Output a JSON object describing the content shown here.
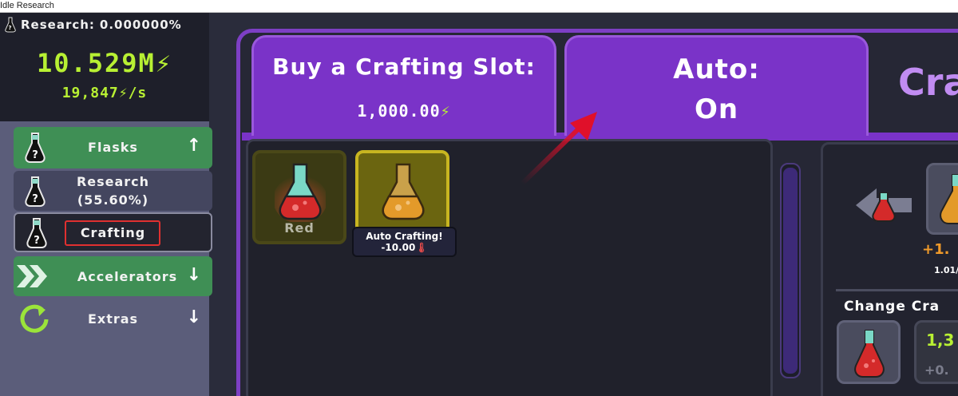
{
  "window": {
    "title": "Idle Research"
  },
  "stats": {
    "research_label": "Research:",
    "research_value": "0.000000%",
    "energy": "10.529M",
    "rate": "19,847",
    "rate_unit": "/s"
  },
  "sidebar": {
    "items": [
      {
        "label": "Flasks",
        "arrow": "↑"
      },
      {
        "label": "Research",
        "sub": "(55.60%)"
      },
      {
        "label": "Crafting"
      },
      {
        "label": "Accelerators",
        "arrow": "↓"
      },
      {
        "label": "Extras",
        "arrow": "↓"
      }
    ]
  },
  "tabs": {
    "buy_title": "Buy a Crafting Slot:",
    "buy_cost": "1,000.00",
    "auto_title": "Auto:",
    "auto_state": "On",
    "partial_title": "Cra"
  },
  "slots": [
    {
      "label": "Red"
    },
    {
      "label": "Auto Crafting!",
      "cost": "-10.00"
    }
  ],
  "right_panel": {
    "gain": "+1.",
    "rate": "1.01/",
    "change_label": "Change Cra",
    "value_a": "1,3",
    "value_b": "+0."
  },
  "colors": {
    "accent_purple": "#7a33c8",
    "energy_green": "#b8f033",
    "nav_green": "#3f8f55",
    "flask_red": "#d42a2a",
    "flask_orange": "#e39a2a"
  },
  "icons": [
    "flask-icon",
    "up-arrow-icon",
    "down-arrow-icon",
    "chevrons-icon",
    "refresh-icon",
    "lightning-icon",
    "thermometer-icon"
  ]
}
